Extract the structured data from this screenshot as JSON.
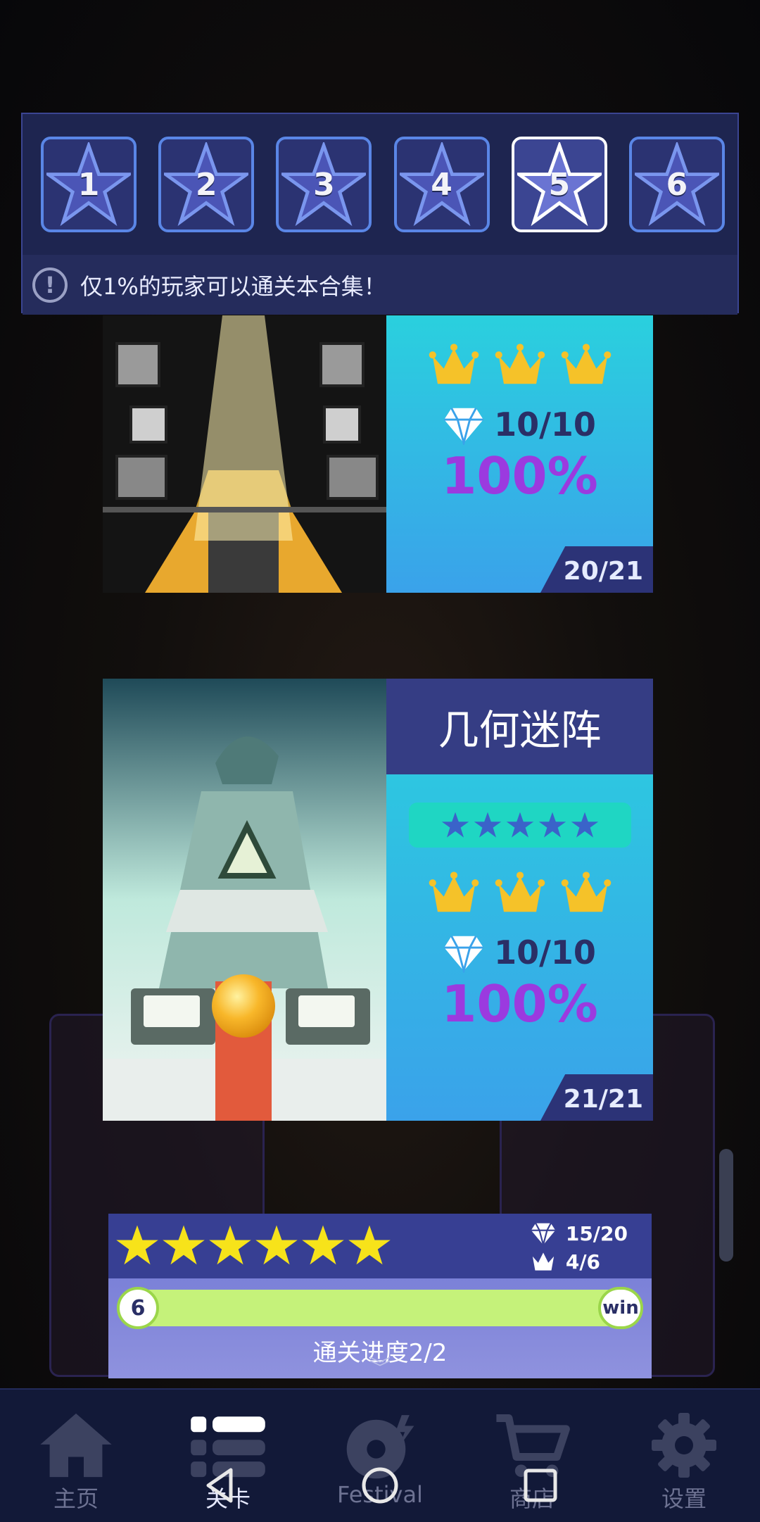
{
  "tabs": [
    {
      "label": "1",
      "active": false
    },
    {
      "label": "2",
      "active": false
    },
    {
      "label": "3",
      "active": false
    },
    {
      "label": "4",
      "active": false
    },
    {
      "label": "5",
      "active": true
    },
    {
      "label": "6",
      "active": false
    }
  ],
  "notice": {
    "icon": "exclamation-icon",
    "text": "仅1%的玩家可以通关本合集！"
  },
  "levels": [
    {
      "title": "",
      "crowns": 3,
      "gems": "10/10",
      "percent": "100%",
      "count": "20/21"
    },
    {
      "title": "几何迷阵",
      "difficulty_stars": 5,
      "crowns": 3,
      "gems": "10/10",
      "percent": "100%",
      "count": "21/21"
    }
  ],
  "collection": {
    "stars": 6,
    "gems": "15/20",
    "crowns": "4/6",
    "bar_start": "6",
    "bar_end": "win",
    "progress_label": "通关进度2/2",
    "progress": 1.0
  },
  "nav": [
    {
      "icon": "home-icon",
      "label": "主页",
      "active": false
    },
    {
      "icon": "level-list-icon",
      "label": "关卡",
      "active": true
    },
    {
      "icon": "disc-icon",
      "label": "Festival",
      "active": false
    },
    {
      "icon": "cart-icon",
      "label": "商店",
      "active": false
    },
    {
      "icon": "gear-icon",
      "label": "设置",
      "active": false
    }
  ],
  "colors": {
    "accent": "#9b3adf",
    "panel": "#1e2550",
    "gold": "#f5c229"
  }
}
